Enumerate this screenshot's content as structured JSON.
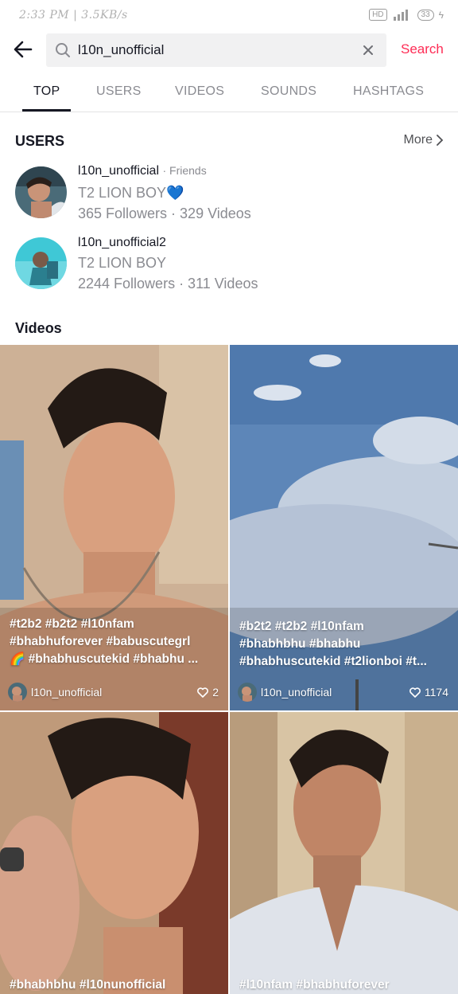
{
  "status_bar": {
    "time_speed": "2:33 PM | 3.5KB/s",
    "battery": "33"
  },
  "search": {
    "query": "l10n_unofficial",
    "button_label": "Search"
  },
  "tabs": [
    "TOP",
    "USERS",
    "VIDEOS",
    "SOUNDS",
    "HASHTAGS"
  ],
  "users_section": {
    "title": "USERS",
    "more_label": "More",
    "items": [
      {
        "username": "l10n_unofficial",
        "relation": "· Friends",
        "bio": "T2 LION BOY💙",
        "stats": "365 Followers · 329 Videos"
      },
      {
        "username": "l10n_unofficial2",
        "relation": "",
        "bio": "T2 LION BOY",
        "stats": "2244 Followers · 311 Videos"
      }
    ]
  },
  "videos_section": {
    "title": "Videos",
    "items": [
      {
        "caption": [
          "#t2b2 #b2t2 #l10nfam",
          "#bhabhuforever #babuscutegrl",
          "🌈 #bhabhuscutekid #bhabhu ..."
        ],
        "author": "l10n_unofficial",
        "likes": "2"
      },
      {
        "caption": [
          "#b2t2 #t2b2 #l10nfam",
          "#bhabhbhu #bhabhu",
          "#bhabhuscutekid #t2lionboi #t..."
        ],
        "author": "l10n_unofficial",
        "likes": "1174"
      },
      {
        "caption": [
          "#bhabhbhu #l10nunofficial"
        ],
        "author": "",
        "likes": ""
      },
      {
        "caption": [
          "#l10nfam #bhabhuforever"
        ],
        "author": "",
        "likes": ""
      }
    ]
  },
  "colors": {
    "accent": "#fe2c55",
    "text_primary": "#161823",
    "text_secondary": "#8a8b91"
  }
}
